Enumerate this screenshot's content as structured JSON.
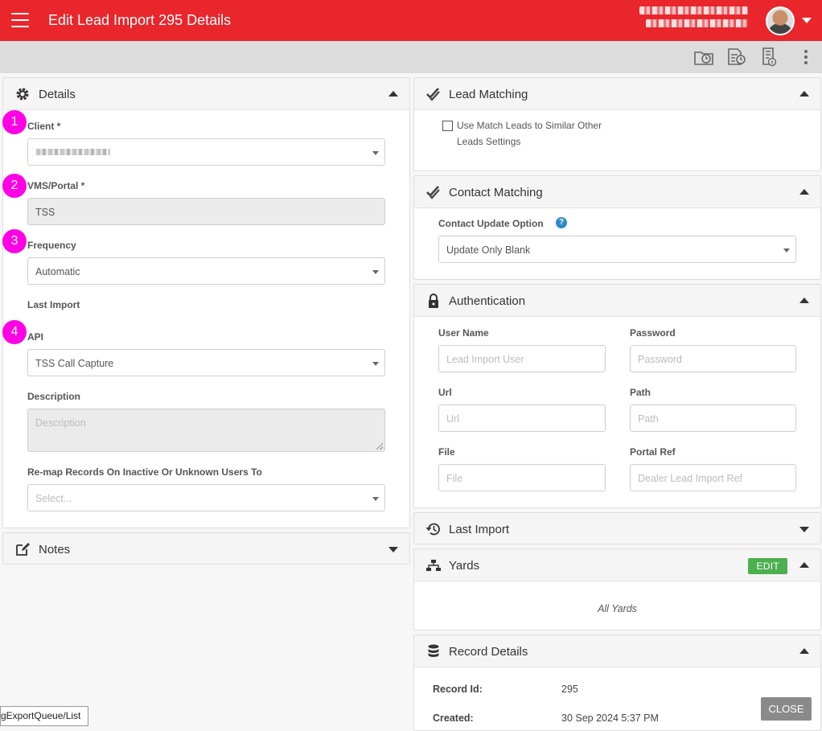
{
  "header": {
    "title": "Edit Lead Import 295 Details",
    "colors": {
      "brand": "#e8262b",
      "marker": "#ff00e6",
      "edit": "#4caf50"
    }
  },
  "toolbar": {
    "icons": [
      "folder-clock-icon",
      "document-clock-icon",
      "document-info-icon",
      "more-vert-icon"
    ]
  },
  "details": {
    "title": "Details",
    "markers": [
      "1",
      "2",
      "3",
      "4"
    ],
    "client_label": "Client *",
    "vms_label": "VMS/Portal *",
    "vms_value": "TSS",
    "frequency_label": "Frequency",
    "frequency_value": "Automatic",
    "last_import_label": "Last Import",
    "api_label": "API",
    "api_value": "TSS Call Capture",
    "description_label": "Description",
    "description_placeholder": "Description",
    "remap_label": "Re-map Records On Inactive Or Unknown Users To",
    "remap_placeholder": "Select..."
  },
  "notes": {
    "title": "Notes"
  },
  "lead_matching": {
    "title": "Lead Matching",
    "checkbox_line1": "Use Match Leads to Similar Other",
    "checkbox_line2": "Leads Settings"
  },
  "contact_matching": {
    "title": "Contact Matching",
    "option_label": "Contact Update Option",
    "help": "?",
    "option_value": "Update Only Blank"
  },
  "authentication": {
    "title": "Authentication",
    "username_label": "User Name",
    "username_placeholder": "Lead Import User",
    "password_label": "Password",
    "password_placeholder": "Password",
    "url_label": "Url",
    "url_placeholder": "Url",
    "path_label": "Path",
    "path_placeholder": "Path",
    "file_label": "File",
    "file_placeholder": "File",
    "portalref_label": "Portal Ref",
    "portalref_placeholder": "Dealer Lead Import Ref"
  },
  "last_import_panel": {
    "title": "Last Import"
  },
  "yards": {
    "title": "Yards",
    "edit_label": "EDIT",
    "value": "All Yards"
  },
  "record_details": {
    "title": "Record Details",
    "id_label": "Record Id:",
    "id_value": "295",
    "created_label": "Created:",
    "created_value": "30 Sep 2024 5:37 PM"
  },
  "close_label": "CLOSE",
  "status_url": "gExportQueue/List"
}
